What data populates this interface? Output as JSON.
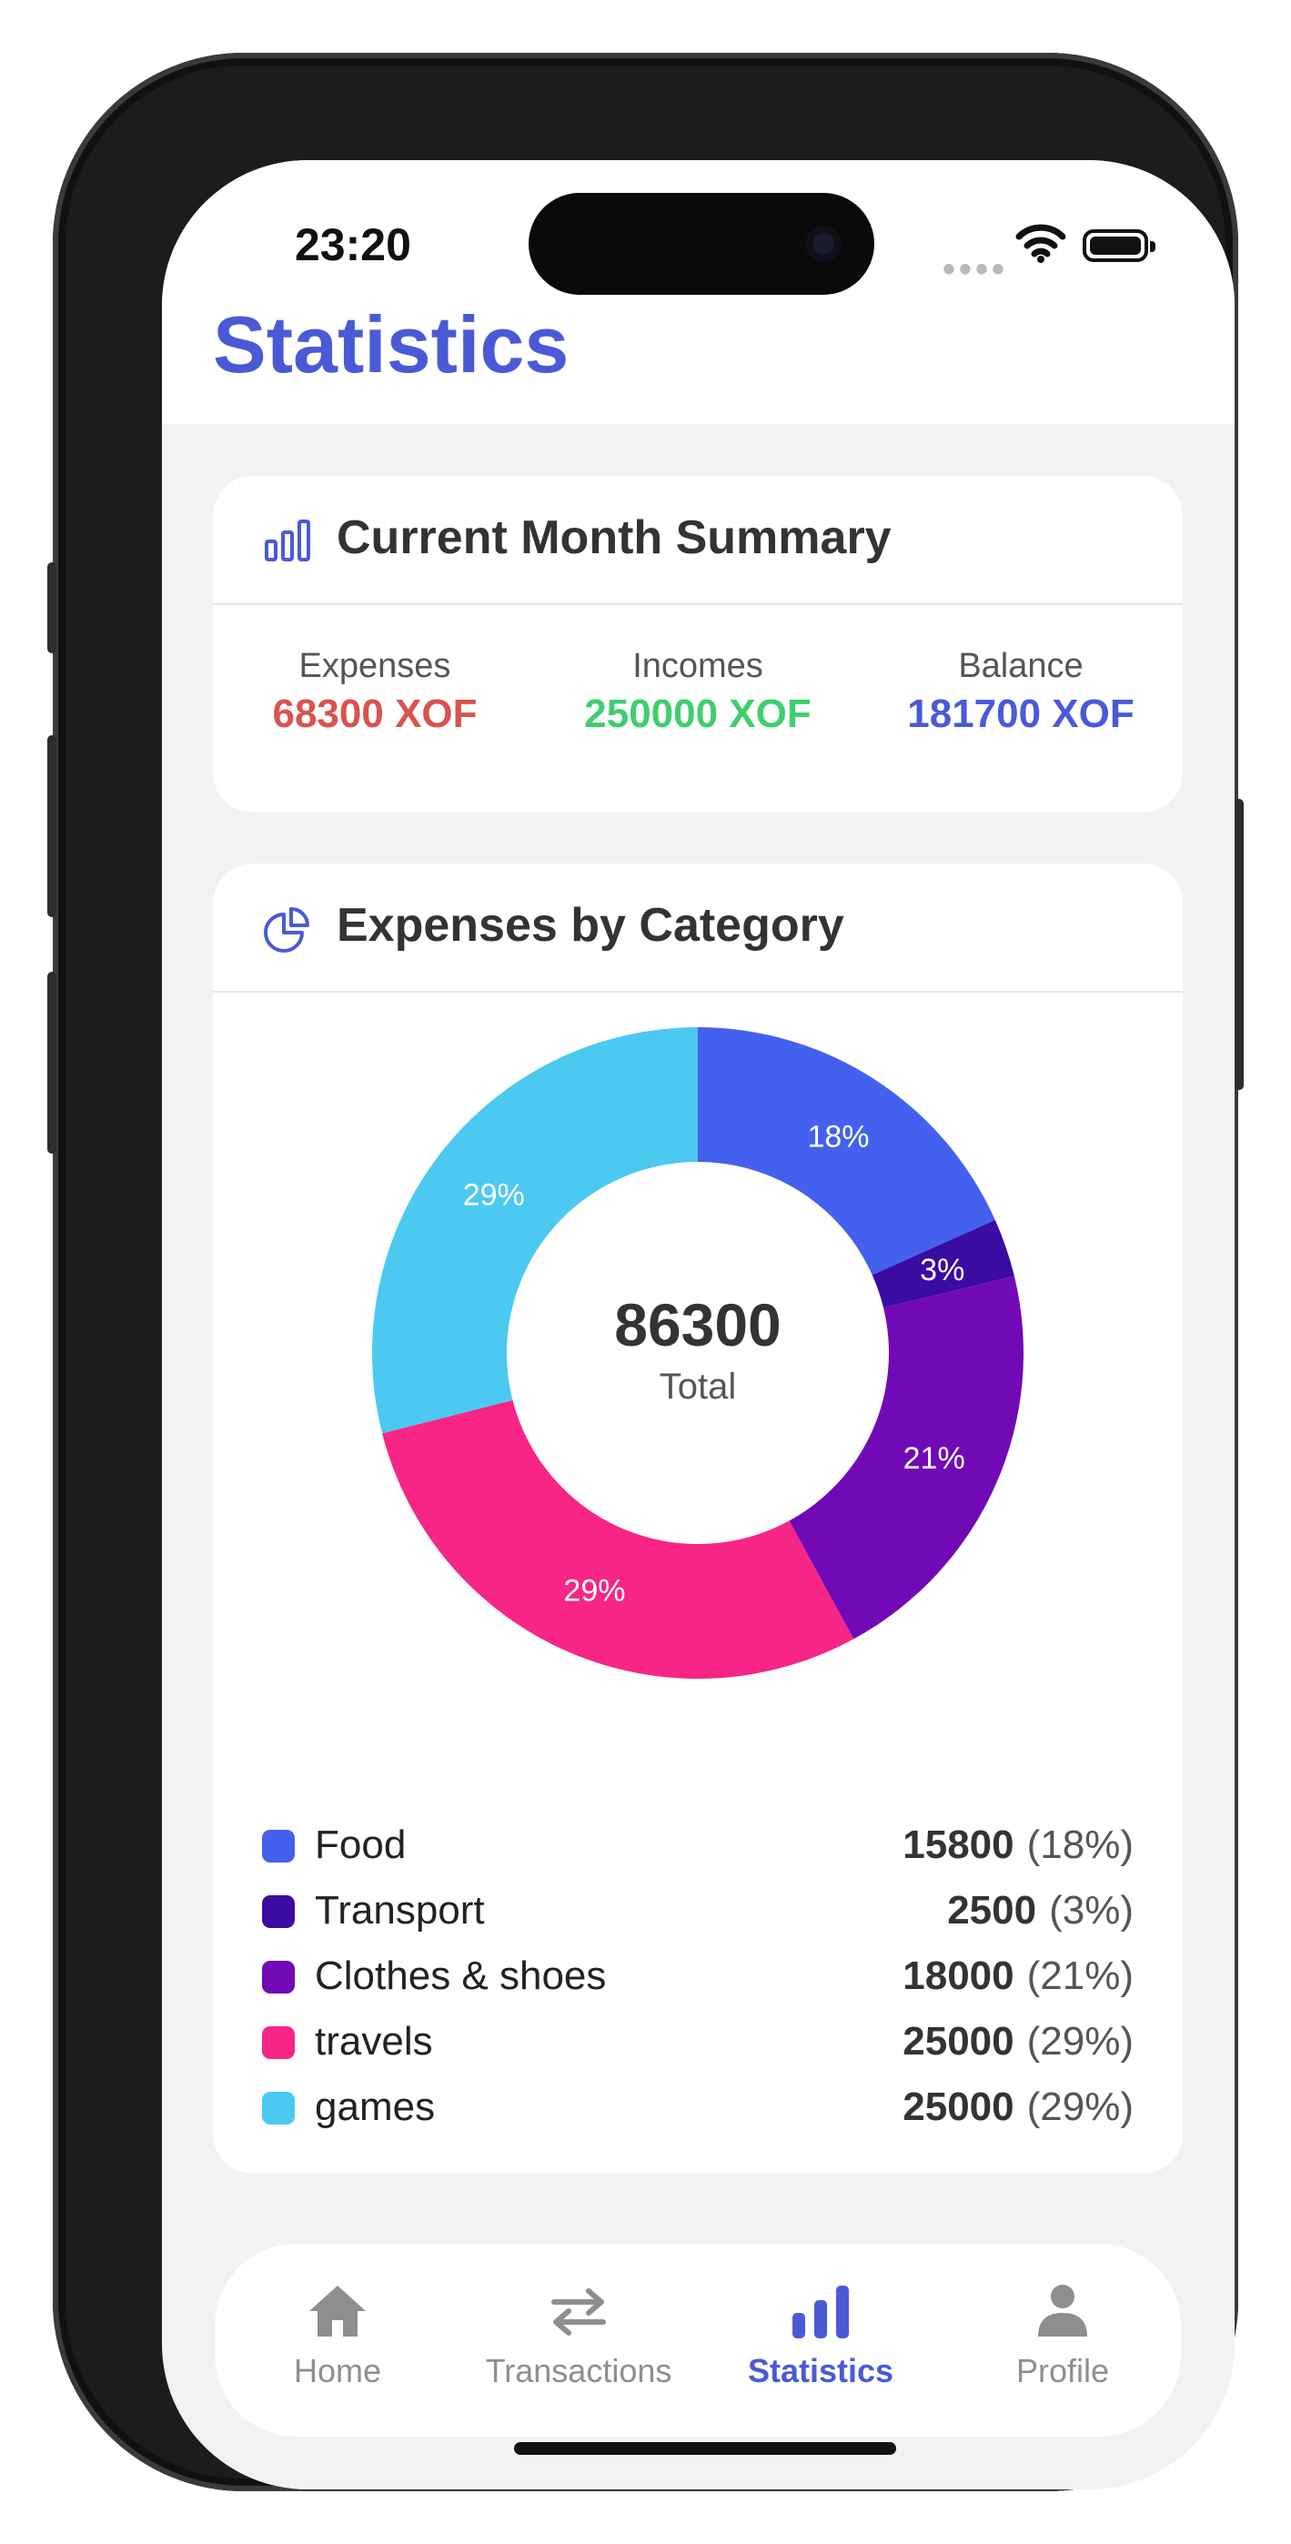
{
  "status_bar": {
    "time": "23:20",
    "signal": "••••"
  },
  "page": {
    "title": "Statistics"
  },
  "summary": {
    "title": "Current Month Summary",
    "icon": "bar-chart-icon",
    "items": [
      {
        "label": "Expenses",
        "value": "68300 XOF",
        "color": "#d9534f"
      },
      {
        "label": "Incomes",
        "value": "250000 XOF",
        "color": "#3fce6e"
      },
      {
        "label": "Balance",
        "value": "181700 XOF",
        "color": "#4a5ad6"
      }
    ]
  },
  "expenses": {
    "title": "Expenses by Category",
    "icon": "pie-chart-icon",
    "center_value": "86300",
    "center_label": "Total"
  },
  "chart_data": {
    "type": "pie",
    "donut": true,
    "categories": [
      "Food",
      "Transport",
      "Clothes & shoes",
      "travels",
      "games"
    ],
    "values": [
      15800,
      2500,
      18000,
      25000,
      25000
    ],
    "percent_labels": [
      "18%",
      "3%",
      "21%",
      "29%",
      "29%"
    ],
    "legend_percent": [
      "(18%)",
      "(3%)",
      "(21%)",
      "(29%)",
      "(29%)"
    ],
    "colors": [
      "#4361ee",
      "#3a0ca3",
      "#7209b7",
      "#f72585",
      "#4cc9f0"
    ],
    "legend": "bottom"
  },
  "tabbar": {
    "tabs": [
      {
        "label": "Home",
        "icon": "home-icon",
        "active": false
      },
      {
        "label": "Transactions",
        "icon": "transfer-arrows-icon",
        "active": false
      },
      {
        "label": "Statistics",
        "icon": "bar-chart-icon",
        "active": true
      },
      {
        "label": "Profile",
        "icon": "person-icon",
        "active": false
      }
    ]
  }
}
